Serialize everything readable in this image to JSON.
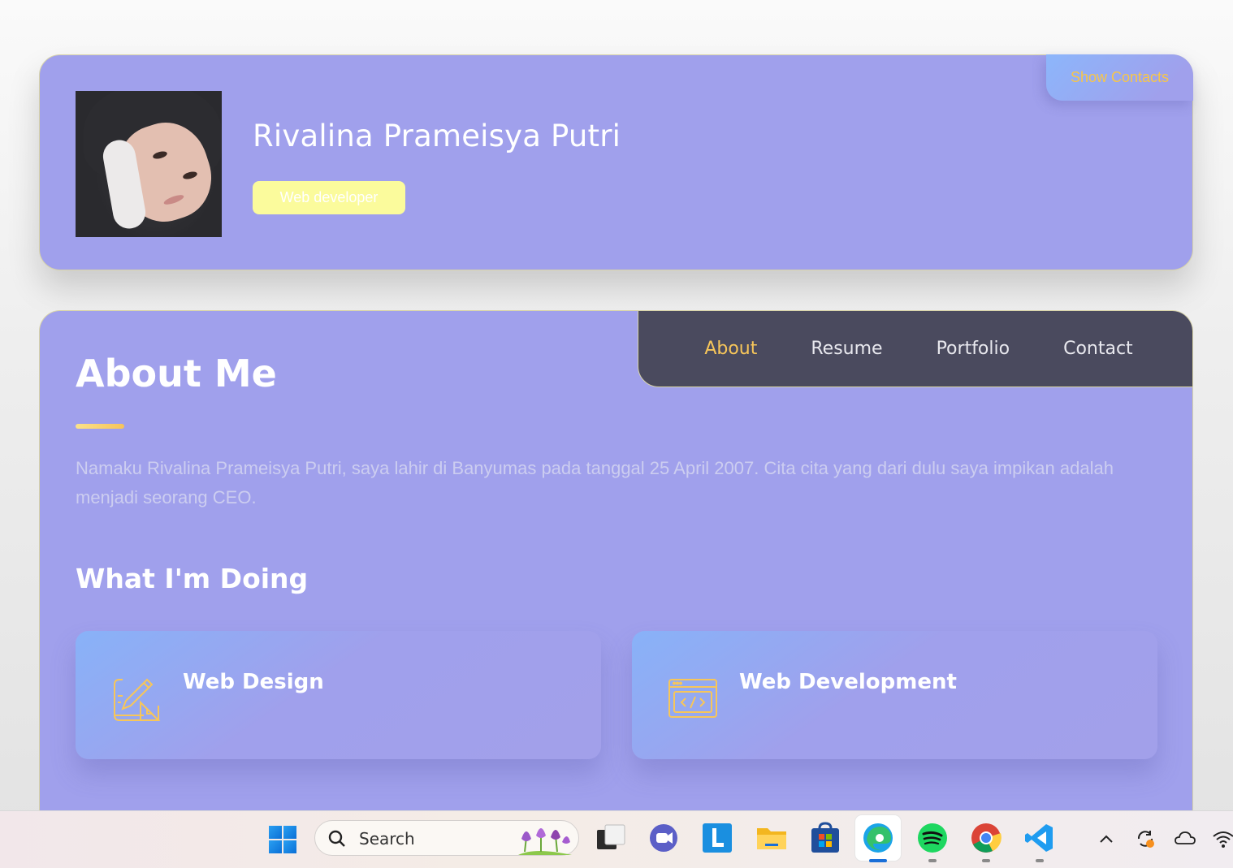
{
  "profile": {
    "name": "Rivalina Prameisya Putri",
    "role": "Web developer",
    "show_contacts_label": "Show Contacts"
  },
  "navbar": {
    "links": [
      "About",
      "Resume",
      "Portfolio",
      "Contact"
    ],
    "active": "About"
  },
  "about": {
    "title": "About Me",
    "text": "Namaku Rivalina Prameisya Putri, saya lahir di Banyumas pada tanggal 25 April 2007. Cita cita yang dari dulu saya impikan adalah menjadi seorang CEO.",
    "services_title": "What I'm Doing",
    "services": [
      {
        "title": "Web Design",
        "icon": "design-icon"
      },
      {
        "title": "Web Development",
        "icon": "code-icon"
      }
    ]
  },
  "taskbar": {
    "search_placeholder": "Search",
    "apps": [
      "task-view-icon",
      "teams-icon",
      "l-app-icon",
      "file-explorer-icon",
      "store-icon",
      "edge-icon",
      "spotify-icon",
      "chrome-icon",
      "vscode-icon"
    ],
    "tray": [
      "chevron-up-icon",
      "sync-icon",
      "onedrive-icon",
      "wifi-icon"
    ]
  },
  "colors": {
    "card_bg": "#a0a0ec",
    "accent_yellow": "#f7c65a",
    "navbar_bg": "#4a4a5e",
    "badge_bg": "#fbfb9c"
  }
}
